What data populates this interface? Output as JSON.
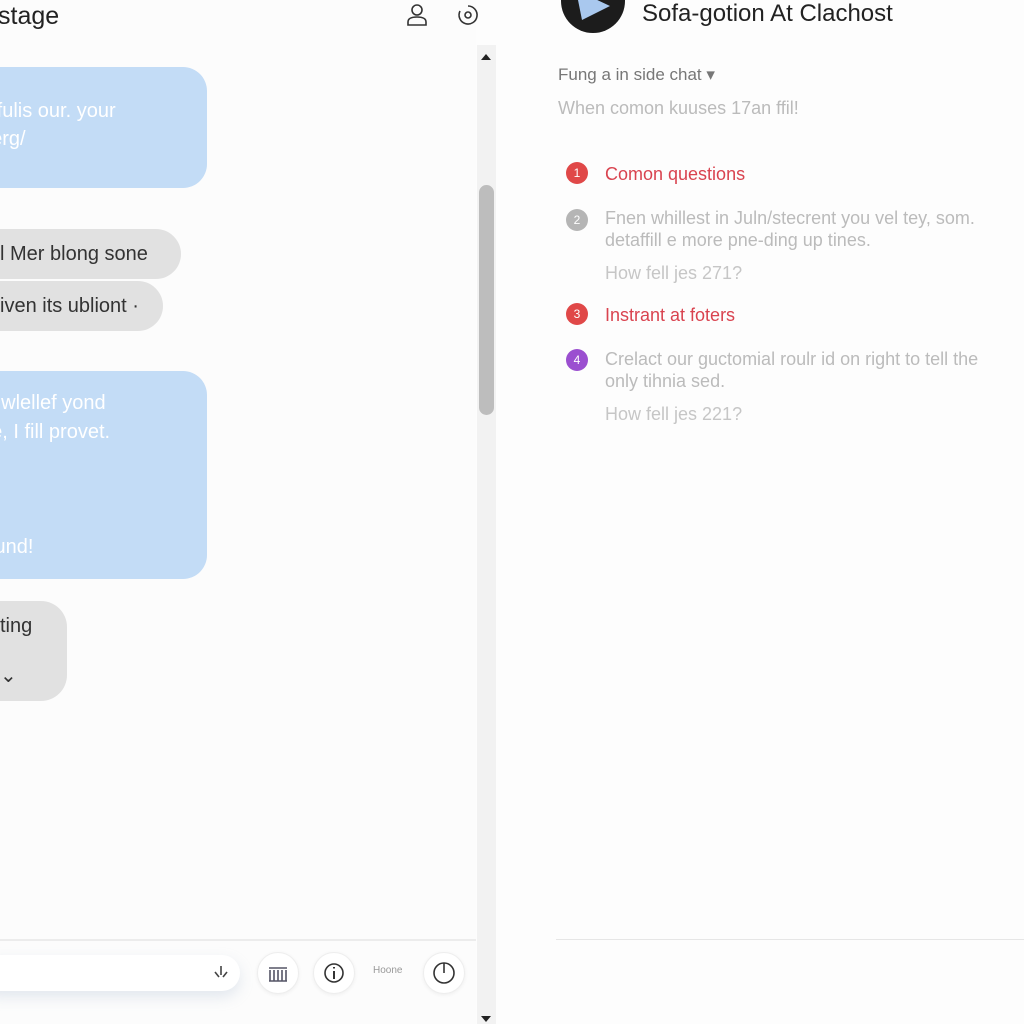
{
  "left_panel": {
    "title": "stage",
    "messages": [
      {
        "type": "sent",
        "lines": [
          "etl fulis our. your",
          "etierg/"
        ]
      },
      {
        "type": "received",
        "text": "l Mer blong sone"
      },
      {
        "type": "received",
        "text": "iven its ubliont ·"
      },
      {
        "type": "sent",
        "lines": [
          "ive wlellef yond",
          "nife, I fill provet.",
          "Pound!"
        ]
      },
      {
        "type": "received",
        "text": "ting ⌄"
      }
    ],
    "toolbar": {
      "label": "Hoone"
    }
  },
  "right_panel": {
    "title": "Sofa-gotion At Clachost",
    "dropdown": "Fung a in side chat ▾",
    "subtitle": "When comon kuuses 17an ffil!",
    "items": [
      {
        "number": "1",
        "color": "#e04848",
        "heading": "Comon questions"
      },
      {
        "number": "2",
        "color": "#b5b5b5",
        "text1": "Fnen whillest in Juln/stecrent you vel tey, som.",
        "text2": "detaffill e more pne-ding up tines.",
        "question": "How fell jes 271?"
      },
      {
        "number": "3",
        "color": "#e04848",
        "heading": "Instrant at foters"
      },
      {
        "number": "4",
        "color": "#9b4fd0",
        "text1": "Crelact our guctomial roulr id on right to tell the",
        "text2": "only tihnia sed.",
        "question": "How fell jes 221?"
      }
    ]
  },
  "colors": {
    "accent_red": "#e04848",
    "sent_bubble": "#c3dcf6",
    "received_bubble": "#e1e1e1"
  }
}
